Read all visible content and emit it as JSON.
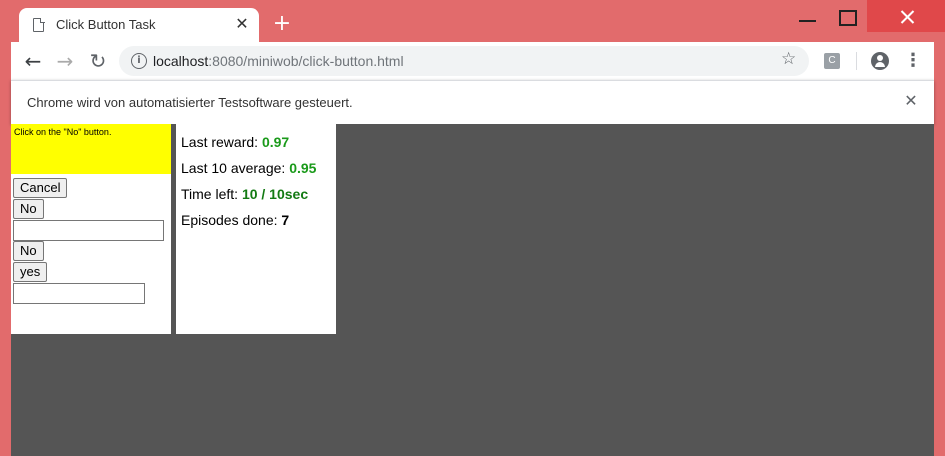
{
  "browser": {
    "tab_title": "Click Button Task",
    "new_tab": "+",
    "url_host": "localhost",
    "url_rest": ":8080/miniwob/click-button.html",
    "infobar_text": "Chrome wird von automatisierter Testsoftware gesteuert.",
    "extension_label": "C"
  },
  "task": {
    "query": "Click on the \"No\" button.",
    "buttons": [
      "Cancel",
      "No",
      "No",
      "yes"
    ],
    "field1_value": "",
    "field2_value": ""
  },
  "stats": {
    "last_reward_label": "Last reward: ",
    "last_reward_value": "0.97",
    "last10_label": "Last 10 average: ",
    "last10_value": "0.95",
    "time_left_label": "Time left: ",
    "time_left_value": "10 / 10sec",
    "episodes_label": "Episodes done: ",
    "episodes_value": "7"
  }
}
